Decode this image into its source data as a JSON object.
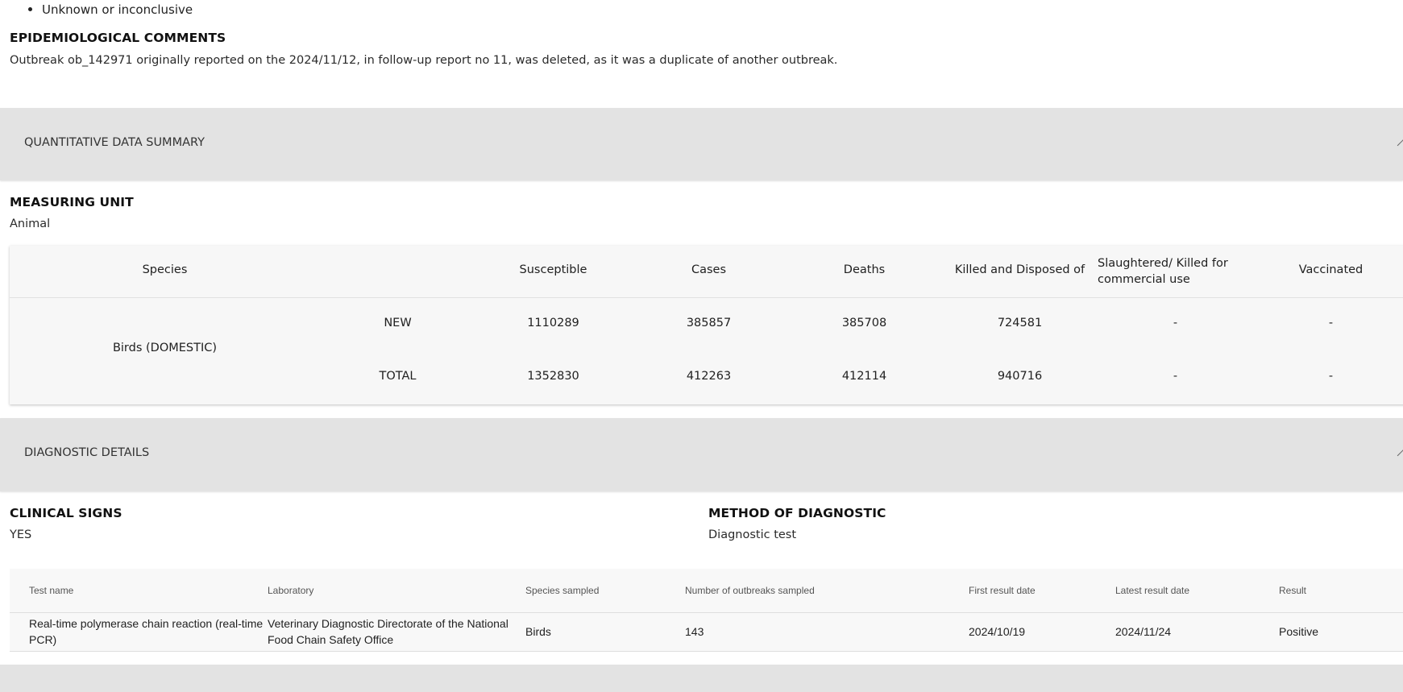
{
  "top_list": {
    "item": "Unknown or inconclusive"
  },
  "epi": {
    "heading": "EPIDEMIOLOGICAL COMMENTS",
    "text": "Outbreak ob_142971 originally reported on the 2024/11/12, in follow-up report no 11, was deleted, as it was a duplicate of another outbreak."
  },
  "quant_section": {
    "title": "QUANTITATIVE DATA SUMMARY"
  },
  "measuring": {
    "heading": "MEASURING UNIT",
    "value": "Animal"
  },
  "quant_table": {
    "headers": {
      "species": "Species",
      "susceptible": "Susceptible",
      "cases": "Cases",
      "deaths": "Deaths",
      "killed": "Killed and Disposed of",
      "slaughtered": "Slaughtered/ Killed for commercial use",
      "vaccinated": "Vaccinated"
    },
    "species": "Birds (DOMESTIC)",
    "rows": [
      {
        "label": "NEW",
        "susceptible": "1110289",
        "cases": "385857",
        "deaths": "385708",
        "killed": "724581",
        "slaughtered": "-",
        "vaccinated": "-"
      },
      {
        "label": "TOTAL",
        "susceptible": "1352830",
        "cases": "412263",
        "deaths": "412114",
        "killed": "940716",
        "slaughtered": "-",
        "vaccinated": "-"
      }
    ]
  },
  "diag_section": {
    "title": "DIAGNOSTIC DETAILS"
  },
  "clinical": {
    "heading": "CLINICAL SIGNS",
    "value": "YES"
  },
  "method": {
    "heading": "METHOD OF DIAGNOSTIC",
    "value": "Diagnostic test"
  },
  "diag_table": {
    "headers": {
      "test_name": "Test name",
      "laboratory": "Laboratory",
      "species_sampled": "Species sampled",
      "outbreaks_sampled": "Number of outbreaks sampled",
      "first_result": "First result date",
      "latest_result": "Latest result date",
      "result": "Result"
    },
    "row": {
      "test_name": "Real-time polymerase chain reaction (real-time PCR)",
      "laboratory": "Veterinary Diagnostic Directorate of the National Food Chain Safety Office",
      "species_sampled": "Birds",
      "outbreaks_sampled": "143",
      "first_result": "2024/10/19",
      "latest_result": "2024/11/24",
      "result": "Positive"
    }
  }
}
